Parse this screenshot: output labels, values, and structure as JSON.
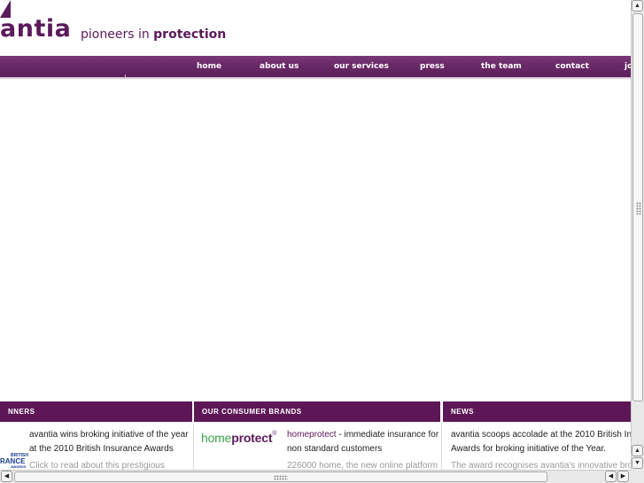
{
  "header": {
    "logo_text": "antia",
    "tagline_pre": "pioneers in ",
    "tagline_strong": "protection"
  },
  "nav": {
    "items": [
      "home",
      "about us",
      "our services",
      "press",
      "the team",
      "contact",
      "jo"
    ]
  },
  "columns": {
    "winners": {
      "heading": "NNERS",
      "text_line1": "avantia wins broking initiative of the year",
      "text_line2": "at the 2010 British Insurance Awards",
      "text_line3": "Click to read about this prestigious",
      "award_logo": [
        "BRITISH",
        "RANCE",
        "AWARDS"
      ]
    },
    "brands": {
      "heading": "OUR CONSUMER BRANDS",
      "logo_home": "home",
      "logo_protect": "protect",
      "logo_tm": "®",
      "link_text": "homeprotect",
      "text_rest": " - immediate insurance for",
      "text_line2": "non standard customers",
      "text_line3": "226000 home, the new online platform"
    },
    "news": {
      "heading": "NEWS",
      "text_line1": "avantia scoops accolade at the 2010 British In",
      "text_line2": "Awards for broking initiative of the Year.",
      "text_line3": "The award recognises avantia's innovative broking"
    }
  },
  "scrollbars": {
    "up_arrow": "▲",
    "down_arrow": "▼",
    "left_arrow": "◀",
    "right_arrow": "▶"
  }
}
